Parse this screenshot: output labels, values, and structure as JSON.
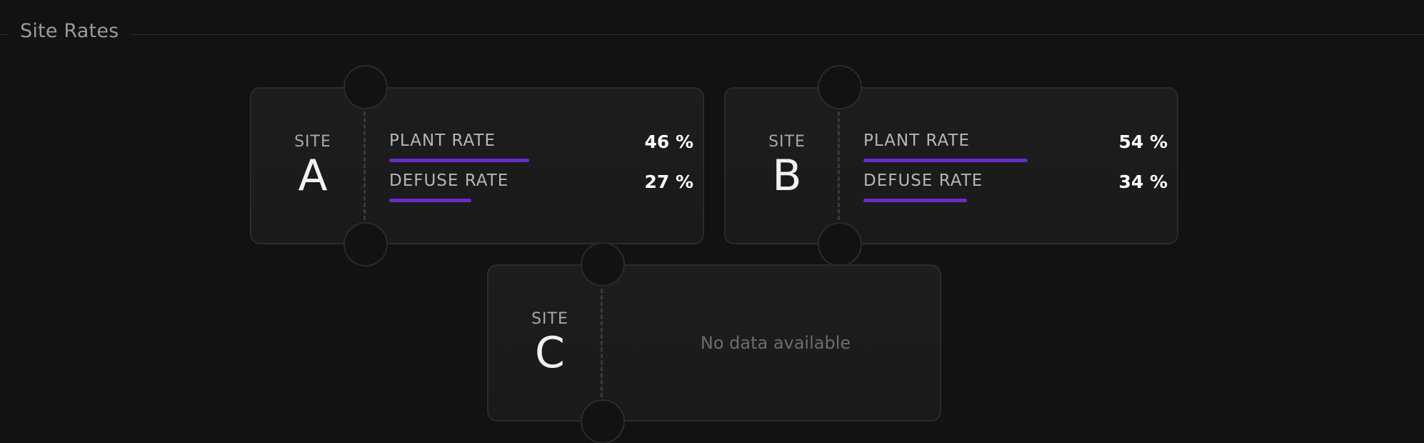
{
  "section": {
    "title": "Site Rates"
  },
  "colors": {
    "background": "#121212",
    "card": "#1c1c1d",
    "accent": "#6a2cc8"
  },
  "sites": [
    {
      "label": "SITE",
      "letter": "A",
      "plant_rate_label": "PLANT RATE",
      "plant_rate_value": "46 %",
      "plant_rate_fraction": 0.46,
      "defuse_rate_label": "DEFUSE RATE",
      "defuse_rate_value": "27 %",
      "defuse_rate_fraction": 0.27
    },
    {
      "label": "SITE",
      "letter": "B",
      "plant_rate_label": "PLANT RATE",
      "plant_rate_value": "54 %",
      "plant_rate_fraction": 0.54,
      "defuse_rate_label": "DEFUSE RATE",
      "defuse_rate_value": "34 %",
      "defuse_rate_fraction": 0.34
    },
    {
      "label": "SITE",
      "letter": "C",
      "empty_message": "No data available"
    }
  ]
}
